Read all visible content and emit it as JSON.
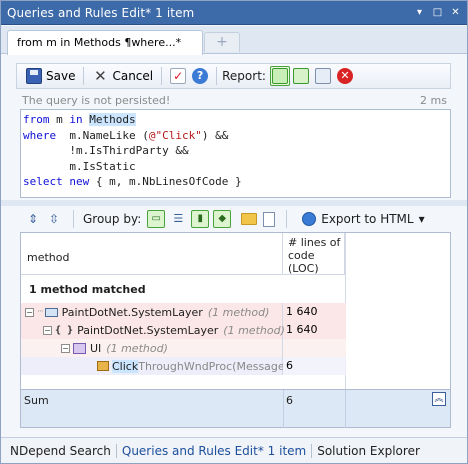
{
  "window": {
    "title": "Queries and Rules Edit*  1 item",
    "controls": [
      "▾",
      "□",
      "✕"
    ]
  },
  "doc_tab": {
    "label": "from m in Methods ¶where...*",
    "new_tab_glyph": "+"
  },
  "toolbar": {
    "save_label": "Save",
    "cancel_label": "Cancel",
    "report_label": "Report:"
  },
  "status": {
    "message": "The query is not persisted!",
    "elapsed": "2 ms"
  },
  "query_code": [
    "from m in Methods",
    "where  m.NameLike (@\"Click\") &&",
    "       !m.IsThirdParty &&",
    "       m.IsStatic",
    "select new { m, m.NbLinesOfCode }"
  ],
  "results_toolbar": {
    "group_by_label": "Group by:",
    "export_label": "Export to HTML"
  },
  "grid": {
    "col_method": "method",
    "col_loc": "# lines of code (LOC)",
    "matched_label": "1 method matched",
    "rows": [
      {
        "name": "PaintDotNet.SystemLayer",
        "note": "(1 method)",
        "loc": "1 640"
      },
      {
        "name": "PaintDotNet.SystemLayer",
        "note": "(1 method)",
        "loc": "1 640"
      },
      {
        "name": "UI",
        "note": "(1 method)",
        "loc": ""
      },
      {
        "name_hl": "Click",
        "name_rest": "ThroughWndProc(Message&",
        "loc": "6"
      }
    ],
    "sum_label": "Sum",
    "sum_value": "6"
  },
  "bottom_tabs": [
    {
      "label": "NDepend Search",
      "active": false
    },
    {
      "label": "Queries and Rules Edit*  1 item",
      "active": true
    },
    {
      "label": "Solution Explorer",
      "active": false
    }
  ]
}
